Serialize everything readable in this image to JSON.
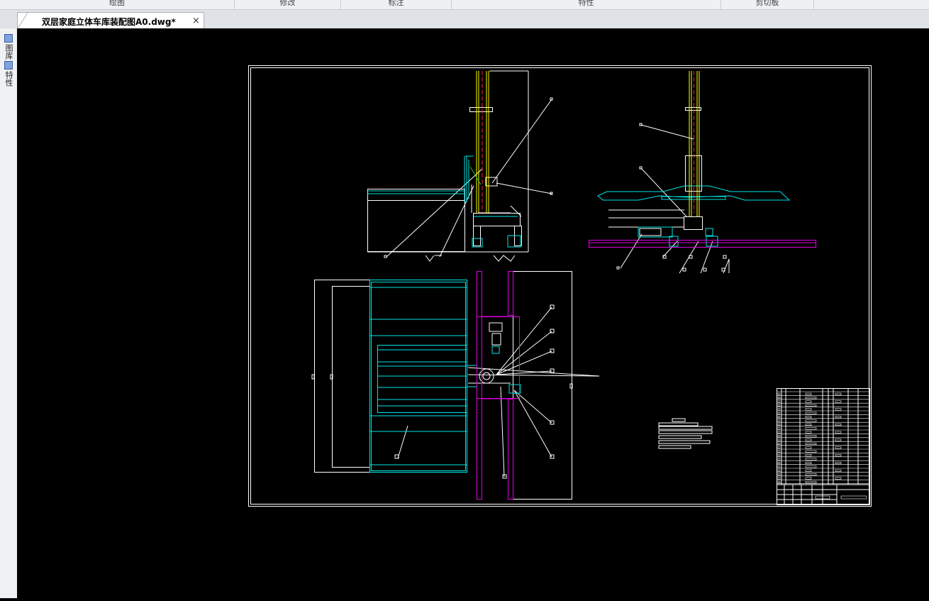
{
  "ribbon": {
    "groups": [
      "绘图",
      "修改",
      "标注",
      "特性",
      "剪切板"
    ]
  },
  "document_tab": {
    "title": "双层家庭立体车库装配图A0.dwg*",
    "close": "×"
  },
  "side_panel": {
    "items": [
      "图库",
      "特性"
    ]
  },
  "colors": {
    "canvas_bg": "#000000",
    "white_lines": "#ffffff",
    "cyan_lines": "#00e5e5",
    "magenta_lines": "#e100e1",
    "yellow_lines": "#ffff00",
    "red_centerlines": "#ff2020",
    "green_lines": "#20c020"
  }
}
